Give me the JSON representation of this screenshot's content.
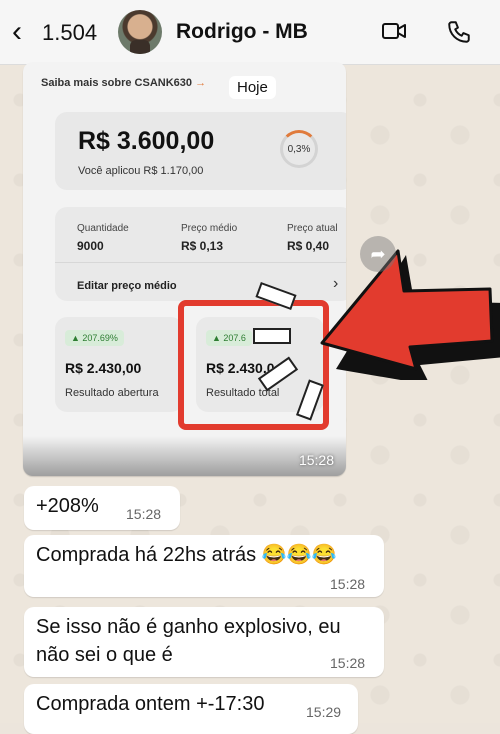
{
  "header": {
    "back_count": "1.504",
    "contact_name": "Rodrigo - MB"
  },
  "screenshot": {
    "saiba_link": "Saiba mais sobre CSANK630",
    "saiba_arrow": "→",
    "date_chip": "Hoje",
    "main_amount": "R$ 3.600,00",
    "applied_text": "Você aplicou R$ 1.170,00",
    "progress_pct": "0,3%",
    "progress_fraction": 0.003,
    "stats": [
      {
        "label": "Quantidade",
        "value": "9000"
      },
      {
        "label": "Preço médio",
        "value": "R$ 0,13"
      },
      {
        "label": "Preço atual",
        "value": "R$ 0,40"
      }
    ],
    "edit_label": "Editar preço médio",
    "edit_chevron": "›",
    "result_open": {
      "badge": "▲ 207.69%",
      "value": "R$ 2.430,00",
      "label": "Resultado abertura"
    },
    "result_total": {
      "badge": "▲ 207.6",
      "value": "R$ 2.430,0",
      "label": "Resultado total"
    },
    "image_time": "15:28",
    "accent_red": "#e23b2e"
  },
  "messages": [
    {
      "text": "+208%",
      "time": "15:28"
    },
    {
      "text": "Comprada há 22hs atrás 😂😂😂",
      "time": "15:28"
    },
    {
      "text_line1": "Se isso não é ganho explosivo, eu",
      "text_line2": "não sei o que é",
      "time": "15:28"
    },
    {
      "text": "Comprada ontem +-17:30",
      "time": "15:29"
    }
  ],
  "icons": {
    "back": "chevron-left-icon",
    "video": "video-camera-icon",
    "phone": "phone-icon",
    "share": "forward-icon"
  }
}
